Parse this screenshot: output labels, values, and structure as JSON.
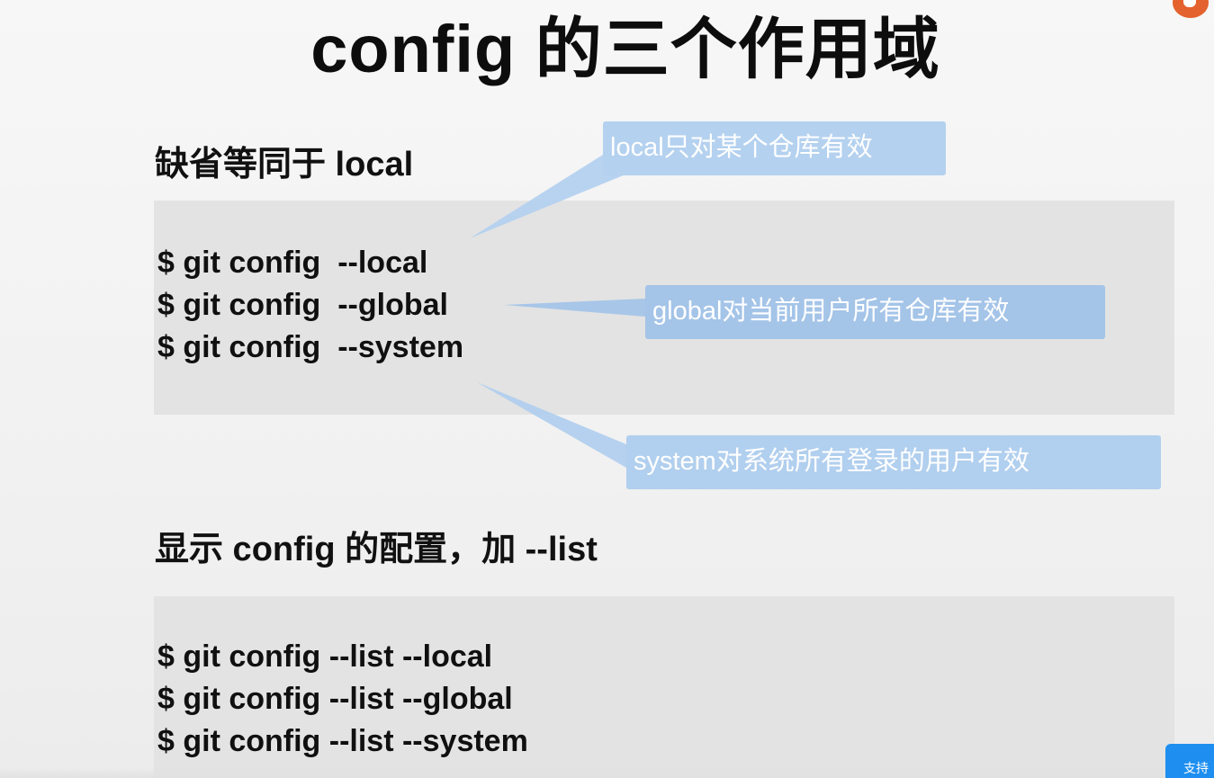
{
  "slide": {
    "title": "config 的三个作用域",
    "section1": {
      "heading": "缺省等同于 local",
      "commands": [
        "$ git config  --local",
        "$ git config  --global",
        "$ git config  --system"
      ]
    },
    "section2": {
      "heading": "显示 config 的配置，加 --list",
      "commands": [
        "$ git config --list --local",
        "$ git config --list --global",
        "$ git config --list --system"
      ]
    },
    "callouts": {
      "local": "local只对某个仓库有效",
      "global": "global对当前用户所有仓库有效",
      "system": "system对系统所有登录的用户有效"
    }
  },
  "overlay": {
    "logo_icon": "orange-mascot-icon",
    "support_button_label": "支持"
  },
  "colors": {
    "callout": "#a9c8ea",
    "code_background": "#e3e3e3",
    "support_button": "#1e8ff0",
    "logo": "#e4622d"
  }
}
